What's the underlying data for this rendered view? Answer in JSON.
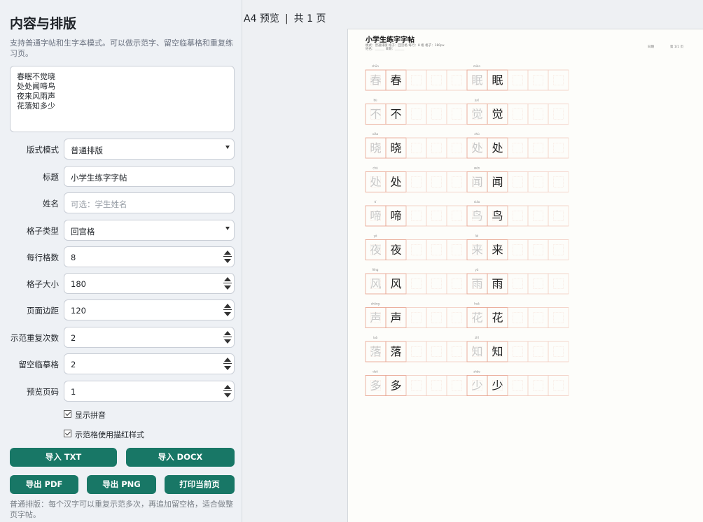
{
  "panel": {
    "title": "内容与排版",
    "description": "支持普通字帖和生字本模式。可以做示范字、留空临摹格和重复练习页。",
    "content": "春眠不觉晓\n处处闻啼鸟\n夜来风雨声\n花落知多少",
    "fields": {
      "layout_mode": {
        "label": "版式模式",
        "value": "普通排版"
      },
      "title": {
        "label": "标题",
        "value": "小学生练字字帖"
      },
      "name": {
        "label": "姓名",
        "placeholder": "可选：学生姓名"
      },
      "grid_type": {
        "label": "格子类型",
        "value": "回宫格"
      },
      "cells_per_row": {
        "label": "每行格数",
        "value": "8"
      },
      "cell_size": {
        "label": "格子大小",
        "value": "180"
      },
      "page_margin": {
        "label": "页面边距",
        "value": "120"
      },
      "demo_repeat": {
        "label": "示范重复次数",
        "value": "2"
      },
      "blank_trace": {
        "label": "留空临摹格",
        "value": "2"
      },
      "preview_page": {
        "label": "预览页码",
        "value": "1"
      }
    },
    "checkboxes": {
      "show_pinyin": {
        "label": "显示拼音",
        "checked": true
      },
      "tracing_style": {
        "label": "示范格使用描红样式",
        "checked": true
      }
    },
    "buttons": {
      "import_txt": "导入 TXT",
      "import_docx": "导入 DOCX",
      "export_pdf": "导出 PDF",
      "export_png": "导出 PNG",
      "print_page": "打印当前页"
    },
    "footnote": "普通排版：每个汉字可以重复示范多次，再追加留空格，适合做整页字帖。"
  },
  "preview": {
    "label": "A4 预览",
    "separator": "|",
    "pages": "共 1 页"
  },
  "sheet": {
    "title": "小学生练字字帖",
    "meta_line1": "模式：普通排版  格子：回宫格  每行：8 格  格子：180px",
    "meta_line2": "姓名：＿＿＿  日期：＿＿＿",
    "meta_right1": "日期",
    "meta_right2": "第 1/1 页",
    "columns": [
      [
        {
          "char": "春",
          "pinyin": "chūn"
        },
        {
          "char": "不",
          "pinyin": "bù"
        },
        {
          "char": "晓",
          "pinyin": "xiǎo"
        },
        {
          "char": "处",
          "pinyin": "chù"
        },
        {
          "char": "啼",
          "pinyin": "tí"
        },
        {
          "char": "夜",
          "pinyin": "yè"
        },
        {
          "char": "风",
          "pinyin": "fēng"
        },
        {
          "char": "声",
          "pinyin": "shēng"
        },
        {
          "char": "落",
          "pinyin": "luò"
        },
        {
          "char": "多",
          "pinyin": "duō"
        }
      ],
      [
        {
          "char": "眠",
          "pinyin": "mián"
        },
        {
          "char": "觉",
          "pinyin": "jué"
        },
        {
          "char": "处",
          "pinyin": "chù"
        },
        {
          "char": "闻",
          "pinyin": "wén"
        },
        {
          "char": "鸟",
          "pinyin": "niǎo"
        },
        {
          "char": "来",
          "pinyin": "lái"
        },
        {
          "char": "雨",
          "pinyin": "yǔ"
        },
        {
          "char": "花",
          "pinyin": "huā"
        },
        {
          "char": "知",
          "pinyin": "zhī"
        },
        {
          "char": "少",
          "pinyin": "shǎo"
        }
      ]
    ]
  },
  "colors": {
    "accent": "#187766",
    "grid_line": "#e8a48f",
    "guide_line": "#f2c8bb",
    "trace_char": "#c9c9c9"
  }
}
